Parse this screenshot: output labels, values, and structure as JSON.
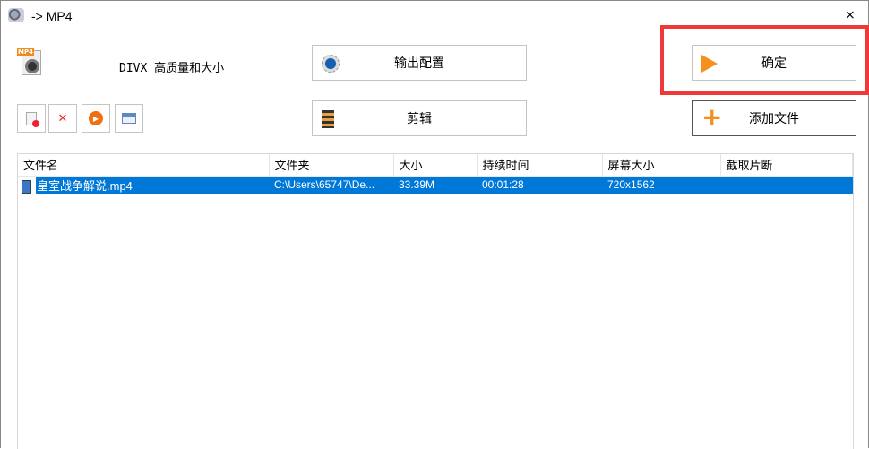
{
  "window": {
    "title": "-> MP4",
    "close": "×"
  },
  "format": {
    "label": "DIVX 高质量和大小",
    "badge": "MP4"
  },
  "buttons": {
    "output_config": "输出配置",
    "ok": "确定",
    "clip": "剪辑",
    "add_file": "添加文件"
  },
  "table": {
    "columns": [
      "文件名",
      "文件夹",
      "大小",
      "持续时间",
      "屏幕大小",
      "截取片断"
    ],
    "rows": [
      {
        "name": "皇室战争解说.mp4",
        "folder": "C:\\Users\\65747\\De...",
        "size": "33.39M",
        "duration": "00:01:28",
        "resolution": "720x1562",
        "clip": ""
      }
    ]
  },
  "colors": {
    "selection": "#0078d7",
    "highlight": "#f03a3a",
    "accent": "#f08a1c"
  }
}
